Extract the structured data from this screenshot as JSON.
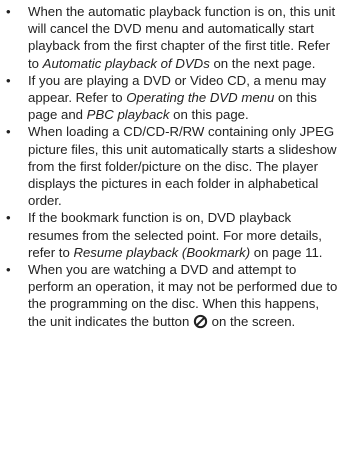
{
  "bullets": [
    {
      "parts": [
        "When the automatic playback function is on, this unit will cancel the DVD menu and automatically start playback from the first chapter of the first title. Refer to ",
        "Automatic playback of DVDs",
        " on the next page."
      ]
    },
    {
      "parts": [
        "If you are playing a DVD or Video CD, a menu may appear. Refer to ",
        "Operating the DVD menu",
        " on this page and ",
        "PBC playback",
        " on this page."
      ]
    },
    {
      "parts": [
        "When loading a CD/CD-R/RW containing only JPEG picture files, this unit automatically starts a slideshow from the first folder/picture on the disc. The player displays the pictures in each folder in alphabetical order."
      ]
    },
    {
      "parts": [
        "If the bookmark function is on, DVD playback resumes from the selected point. For more details, refer to ",
        "Resume playback (Bookmark)",
        " on page 11."
      ]
    },
    {
      "parts": [
        "When you are watching a DVD and attempt to perform an operation, it may not be performed due to the programming on the disc. When this happens, the unit indicates the button ",
        " on the screen."
      ],
      "icon": "prohibited-icon"
    }
  ]
}
